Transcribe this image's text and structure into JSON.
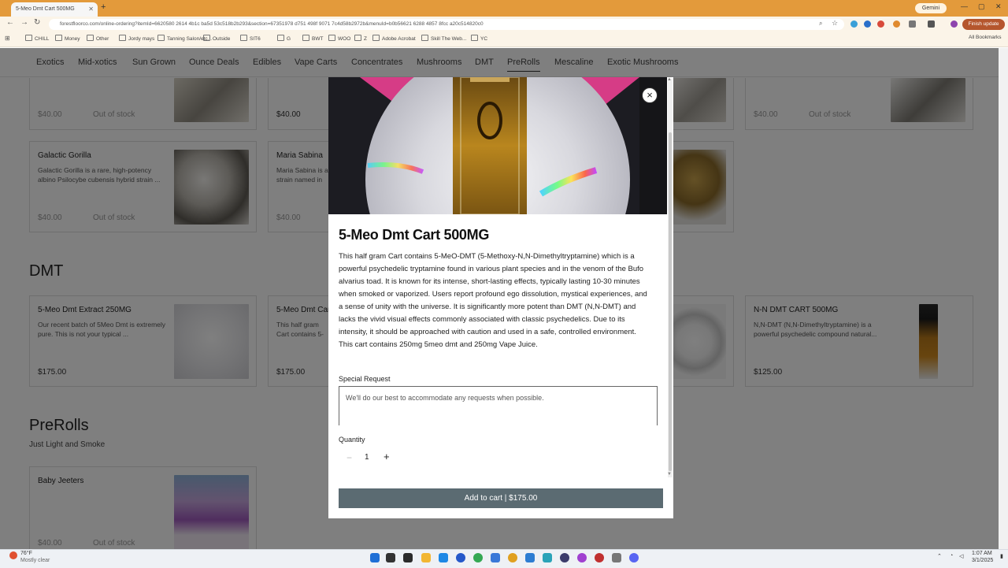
{
  "browser": {
    "tab_title": "5-Meo Dmt Cart 500MG",
    "new_tab": "+",
    "gemini": "Gemini",
    "url": "forestfloorco.com/online-ordering?itemId=6620580 2614 4b1c ba5d 53c518b2b293&section=67351978 d751 498f 9071 7c4d58b2972b&menuId=b0b56621 6288 4857 8fcc a20c514820c0",
    "finish_update": "Finish update",
    "bookmarks": [
      "CHILL",
      "Money",
      "Other",
      "Jordy mays",
      "Tanning Salon/etc...",
      "Outside",
      "SIT6",
      "G",
      "BWT",
      "WOO",
      "Z",
      "Adobe Acrobat",
      "Skill The Web...",
      "YC"
    ],
    "all_bookmarks": "All Bookmarks"
  },
  "nav": {
    "categories": [
      "Exotics",
      "Mid-xotics",
      "Sun Grown",
      "Ounce Deals",
      "Edibles",
      "Vape Carts",
      "Concentrates",
      "Mushrooms",
      "DMT",
      "PreRolls",
      "Mescaline",
      "Exotic Mushrooms"
    ],
    "active": "PreRolls"
  },
  "page": {
    "top_cards": [
      {
        "price": "$40.00",
        "status": "Out of stock"
      },
      {
        "price": "$40.00",
        "status": ""
      },
      {
        "price": "$40.00",
        "status": "Out of stock"
      }
    ],
    "mushroom_cards": [
      {
        "title": "Galactic Gorilla",
        "desc": "Galactic Gorilla is a rare, high-potency albino Psilocybe cubensis hybrid strain ...",
        "price": "$40.00",
        "status": "Out of stock"
      },
      {
        "title": "Maria Sabina",
        "desc": "Maria Sabina is a strain named in t...",
        "price": "$40.00",
        "status": "Out of stock"
      }
    ],
    "dmt_heading": "DMT",
    "dmt_cards": [
      {
        "title": "5-Meo Dmt Extract 250MG",
        "desc": "Our recent batch of 5Meo Dmt is extremely pure. This is not your typical ...",
        "price": "$175.00"
      },
      {
        "title": "5-Meo Dmt Cart 500MG",
        "desc": "This half gram Cart contains 5-MeO-DMT (5-Methoxy-N,N-...",
        "price": "$175.00"
      },
      {
        "title": "N-N DMT CART 500MG",
        "desc": "N,N-DMT (N,N-Dimethyltryptamine) is a powerful psychedelic compound natural...",
        "price": "$125.00"
      }
    ],
    "prerolls_heading": "PreRolls",
    "prerolls_sub": "Just Light and Smoke",
    "preroll_cards": [
      {
        "title": "Baby Jeeters",
        "price": "$40.00",
        "status": "Out of stock"
      }
    ]
  },
  "modal": {
    "title": "5-Meo Dmt Cart 500MG",
    "description": "This half gram Cart contains 5-MeO-DMT (5-Methoxy-N,N-Dimethyltryptamine) which is a powerful psychedelic tryptamine found in various plant species and in the venom of the Bufo alvarius toad. It is known for its intense, short-lasting effects, typically lasting 10-30 minutes when smoked or vaporized. Users report profound ego dissolution, mystical experiences, and a sense of unity with the universe. It is significantly more potent than DMT (N,N-DMT) and lacks the vivid visual effects commonly associated with classic psychedelics. Due to its intensity, it should be approached with caution and used in a safe, controlled environment. This cart contains 250mg 5meo dmt and 250mg Vape Juice.",
    "special_request_label": "Special Request",
    "special_request_placeholder": "We'll do our best to accommodate any requests when possible.",
    "quantity_label": "Quantity",
    "quantity": "1",
    "minus": "−",
    "plus": "+",
    "add_to_cart": "Add to cart | $175.00",
    "close": "×"
  },
  "taskbar": {
    "weather_temp": "76°F",
    "weather_text": "Mostly clear",
    "time": "1:07 AM",
    "date": "3/1/2025"
  }
}
